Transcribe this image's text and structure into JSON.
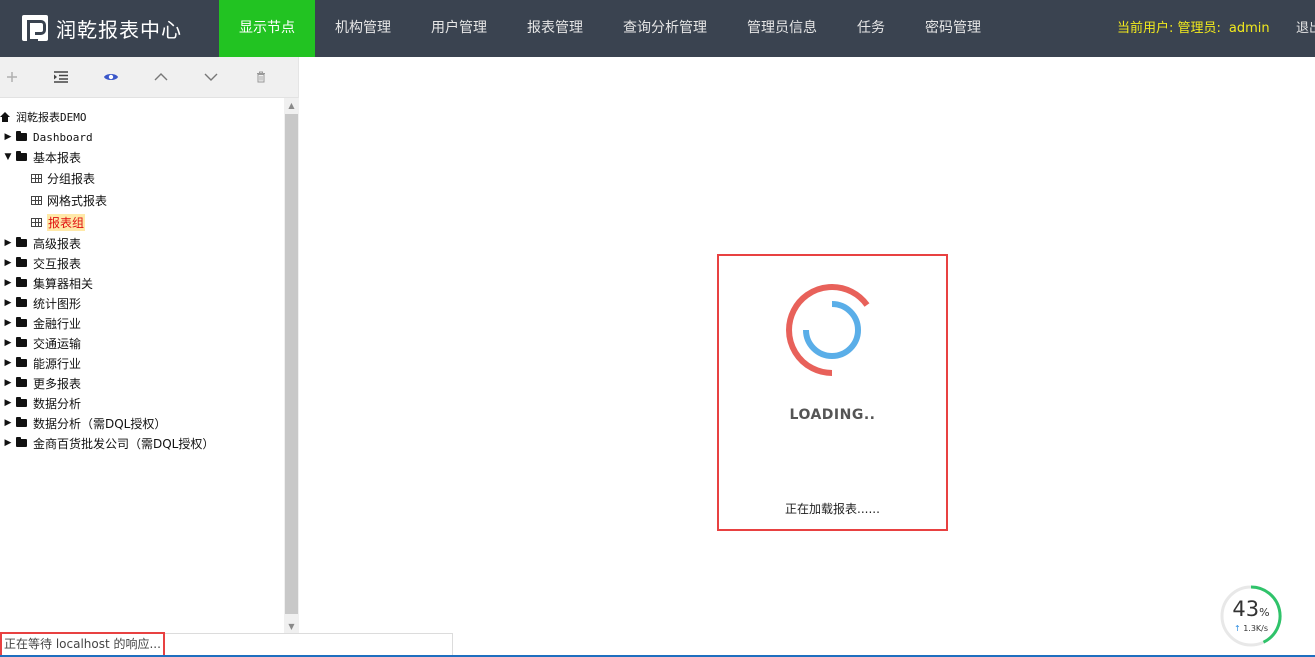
{
  "app": {
    "title": "润乾报表中心"
  },
  "nav": {
    "items": [
      {
        "label": "显示节点",
        "active": true
      },
      {
        "label": "机构管理",
        "active": false
      },
      {
        "label": "用户管理",
        "active": false
      },
      {
        "label": "报表管理",
        "active": false
      },
      {
        "label": "查询分析管理",
        "active": false
      },
      {
        "label": "管理员信息",
        "active": false
      },
      {
        "label": "任务",
        "active": false
      },
      {
        "label": "密码管理",
        "active": false
      }
    ],
    "user_label": "当前用户: 管理员:",
    "user_name": "admin",
    "logout": "退出"
  },
  "toolbar": {
    "icons": [
      "plus-icon",
      "indent-list-icon",
      "eye-icon",
      "chevron-up-icon",
      "chevron-down-icon",
      "trash-icon"
    ]
  },
  "tree": {
    "root": "润乾报表DEMO",
    "nodes": [
      {
        "label": "Dashboard",
        "type": "folder",
        "expanded": false,
        "level": 1
      },
      {
        "label": "基本报表",
        "type": "folder",
        "expanded": true,
        "level": 1
      },
      {
        "label": "分组报表",
        "type": "report",
        "level": 2
      },
      {
        "label": "网格式报表",
        "type": "report",
        "level": 2
      },
      {
        "label": "报表组",
        "type": "report",
        "level": 2,
        "selected": true
      },
      {
        "label": "高级报表",
        "type": "folder",
        "expanded": false,
        "level": 1
      },
      {
        "label": "交互报表",
        "type": "folder",
        "expanded": false,
        "level": 1
      },
      {
        "label": "集算器相关",
        "type": "folder",
        "expanded": false,
        "level": 1
      },
      {
        "label": "统计图形",
        "type": "folder",
        "expanded": false,
        "level": 1
      },
      {
        "label": "金融行业",
        "type": "folder",
        "expanded": false,
        "level": 1
      },
      {
        "label": "交通运输",
        "type": "folder",
        "expanded": false,
        "level": 1
      },
      {
        "label": "能源行业",
        "type": "folder",
        "expanded": false,
        "level": 1
      },
      {
        "label": "更多报表",
        "type": "folder",
        "expanded": false,
        "level": 1
      },
      {
        "label": "数据分析",
        "type": "folder",
        "expanded": false,
        "level": 1
      },
      {
        "label": "数据分析（需DQL授权）",
        "type": "folder",
        "expanded": false,
        "level": 1
      },
      {
        "label": "金商百货批发公司（需DQL授权）",
        "type": "folder",
        "expanded": false,
        "level": 1
      }
    ]
  },
  "loading": {
    "title": "LOADING..",
    "message": "正在加载报表......",
    "spinner_outer_color": "#e8615a",
    "spinner_inner_color": "#5aaee8",
    "border_color": "#e84141"
  },
  "status": {
    "text": "正在等待 localhost 的响应..."
  },
  "network": {
    "percent": "43",
    "percent_unit": "%",
    "speed": "1.3K/s",
    "arrow": "↑"
  },
  "colors": {
    "topbar": "#3a4350",
    "active_nav": "#22c322",
    "user_text": "#f2ea1d"
  }
}
